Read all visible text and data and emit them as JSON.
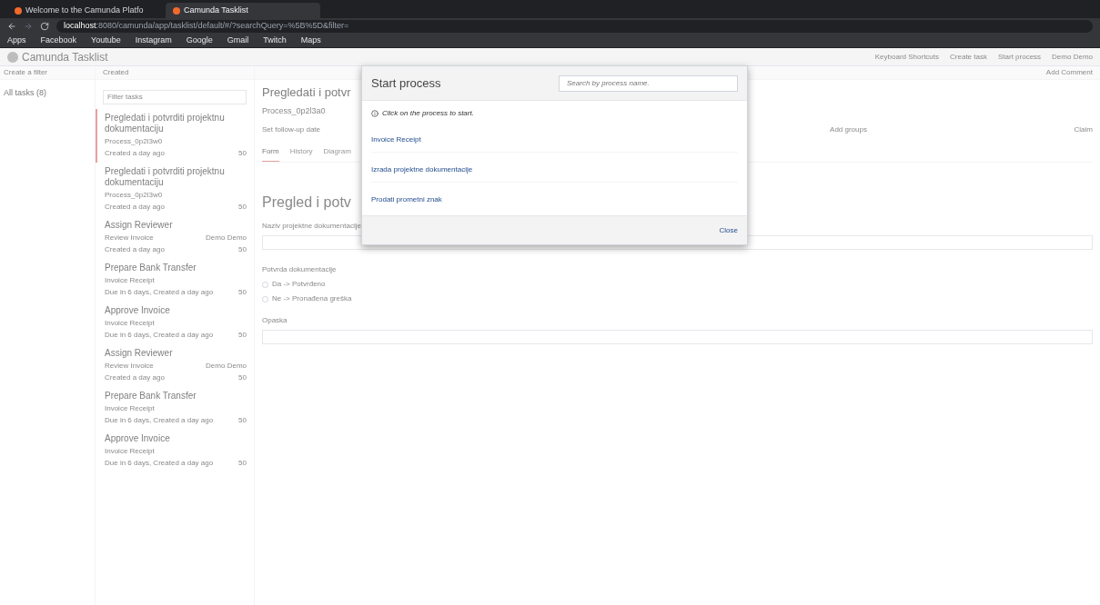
{
  "browser": {
    "tabs": [
      {
        "title": "Welcome to the Camunda Platfo",
        "selected": false
      },
      {
        "title": "Camunda Tasklist",
        "selected": true
      }
    ],
    "url_host": "localhost",
    "url_rest": ":8080/camunda/app/tasklist/default/#/?searchQuery=%5B%5D&filter=",
    "bookmarks": [
      "Apps",
      "Facebook",
      "Youtube",
      "Instagram",
      "Google",
      "Gmail",
      "Twitch",
      "Maps"
    ]
  },
  "app": {
    "title": "Camunda Tasklist",
    "header_links": [
      "Keyboard Shortcuts",
      "Create task",
      "Start process",
      "Demo Demo"
    ]
  },
  "filters": {
    "create_label": "Create a filter",
    "items": [
      {
        "label": "All tasks (8)",
        "selected": true
      }
    ]
  },
  "task_list": {
    "sort_label": "Created",
    "search_placeholder": "Filter tasks",
    "tasks": [
      {
        "name": "Pregledati i potvrditi projektnu dokumentaciju",
        "process": "Process_0p2l3w0",
        "meta": "Created a day ago",
        "priority": "50",
        "selected": true
      },
      {
        "name": "Pregledati i potvrditi projektnu dokumentaciju",
        "process": "Process_0p2l3w0",
        "meta": "Created a day ago",
        "priority": "50",
        "selected": false
      },
      {
        "name": "Assign Reviewer",
        "process": "Review Invoice",
        "assignee": "Demo Demo",
        "meta": "Created a day ago",
        "priority": "50",
        "selected": false
      },
      {
        "name": "Prepare Bank Transfer",
        "process": "Invoice Receipt",
        "meta": "Due in 6 days, Created a day ago",
        "priority": "50",
        "selected": false
      },
      {
        "name": "Approve Invoice",
        "process": "Invoice Receipt",
        "meta": "Due in 6 days, Created a day ago",
        "priority": "50",
        "selected": false
      },
      {
        "name": "Assign Reviewer",
        "process": "Review Invoice",
        "assignee": "Demo Demo",
        "meta": "Created a day ago",
        "priority": "50",
        "selected": false
      },
      {
        "name": "Prepare Bank Transfer",
        "process": "Invoice Receipt",
        "meta": "Due in 6 days, Created a day ago",
        "priority": "50",
        "selected": false
      },
      {
        "name": "Approve Invoice",
        "process": "Invoice Receipt",
        "meta": "Due in 6 days, Created a day ago",
        "priority": "50",
        "selected": false
      }
    ]
  },
  "task_detail": {
    "title": "Pregledati i potvr",
    "process": "Process_0p2l3a0",
    "follow_up": "Set follow-up date",
    "groups": "Add groups",
    "claim": "Claim",
    "add_comment": "Add Comment",
    "tabs": [
      {
        "label": "Form",
        "selected": true
      },
      {
        "label": "History",
        "selected": false
      },
      {
        "label": "Diagram",
        "selected": false
      }
    ],
    "form": {
      "heading": "Pregled i potv",
      "name_label": "Naziv projektne dokumentacije",
      "confirm_label": "Potvrda dokumentacije",
      "options": [
        {
          "label": "Da -> Potvrđeno",
          "selected": false
        },
        {
          "label": "Ne -> Pronađena greška",
          "selected": false
        }
      ],
      "note_label": "Opaska"
    }
  },
  "modal": {
    "title": "Start process",
    "search_placeholder": "Search by process name.",
    "hint": "Click on the process to start.",
    "processes": [
      "Invoice Receipt",
      "Izrada projektne dokumentacije",
      "Prodati prometni znak"
    ],
    "close": "Close"
  }
}
